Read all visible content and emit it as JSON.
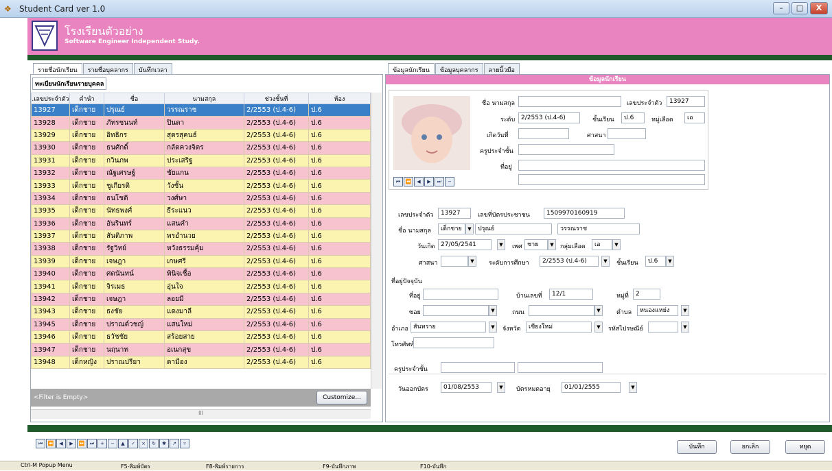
{
  "window": {
    "title": "Student Card ver 1.0",
    "minimize": "–",
    "maximize": "□",
    "close": "X"
  },
  "header": {
    "school_name": "โรงเรียนตัวอย่าง",
    "subtitle": "Software Engineer Independent Study."
  },
  "left": {
    "tabs": [
      "รายชื่อนักเรียน",
      "รายชื่อบุคลากร",
      "บันทึกเวลา"
    ],
    "group_label": "ทะเบียนนักเรียนรายบุคคล",
    "columns": [
      ".เลขประจำตัว",
      "คำนำ",
      "ชื่อ",
      "นามสกุล",
      "ช่วงชั้นที่",
      "ห้อง"
    ],
    "rows": [
      [
        "13927",
        "เด็กชาย",
        "ปรุณย์",
        "วรรณราช",
        "2/2553 (ป.4-6)",
        "ป.6"
      ],
      [
        "13928",
        "เด็กชาย",
        "ภัทรชนนท์",
        "ปินตา",
        "2/2553 (ป.4-6)",
        "ป.6"
      ],
      [
        "13929",
        "เด็กชาย",
        "อิทธิกร",
        "สุตรสุคนธ์",
        "2/2553 (ป.4-6)",
        "ป.6"
      ],
      [
        "13930",
        "เด็กชาย",
        "ธนศักดิ์",
        "กลัดควงจิตร",
        "2/2553 (ป.4-6)",
        "ป.6"
      ],
      [
        "13931",
        "เด็กชาย",
        "กวินภพ",
        "ประเสริฐ",
        "2/2553 (ป.4-6)",
        "ป.6"
      ],
      [
        "13932",
        "เด็กชาย",
        "ณัฐเศรษฐ์",
        "ชัยแกน",
        "2/2553 (ป.4-6)",
        "ป.6"
      ],
      [
        "13933",
        "เด็กชาย",
        "ชูเกียรติ",
        "วังชั้น",
        "2/2553 (ป.4-6)",
        "ป.6"
      ],
      [
        "13934",
        "เด็กชาย",
        "ธนโชติ",
        "วงศ์ษา",
        "2/2553 (ป.4-6)",
        "ป.6"
      ],
      [
        "13935",
        "เด็กชาย",
        "นัทธพงศ์",
        "ธีระแนว",
        "2/2553 (ป.4-6)",
        "ป.6"
      ],
      [
        "13936",
        "เด็กชาย",
        "อันรินทร์",
        "แสนคำ",
        "2/2553 (ป.4-6)",
        "ป.6"
      ],
      [
        "13937",
        "เด็กชาย",
        "สันติภาพ",
        "พรอำนวย",
        "2/2553 (ป.4-6)",
        "ป.6"
      ],
      [
        "13938",
        "เด็กชาย",
        "รัฐวิทย์",
        "หวังธรรมคุ้ม",
        "2/2553 (ป.4-6)",
        "ป.6"
      ],
      [
        "13939",
        "เด็กชาย",
        "เจษฎา",
        "เกษศรี",
        "2/2553 (ป.4-6)",
        "ป.6"
      ],
      [
        "13940",
        "เด็กชาย",
        "ศดนันทน์",
        "พินิจเชื้อ",
        "2/2553 (ป.4-6)",
        "ป.6"
      ],
      [
        "13941",
        "เด็กชาย",
        "จิรเมธ",
        "อุ่นใจ",
        "2/2553 (ป.4-6)",
        "ป.6"
      ],
      [
        "13942",
        "เด็กชาย",
        "เจษฎา",
        "ลอยมี",
        "2/2553 (ป.4-6)",
        "ป.6"
      ],
      [
        "13943",
        "เด็กชาย",
        "ธงชัย",
        "แดงมาลี",
        "2/2553 (ป.4-6)",
        "ป.6"
      ],
      [
        "13945",
        "เด็กชาย",
        "ปราณต์วชญ์",
        "แสนใหม่",
        "2/2553 (ป.4-6)",
        "ป.6"
      ],
      [
        "13946",
        "เด็กชาย",
        "ธวัชชัย",
        "สร้อยสาย",
        "2/2553 (ป.4-6)",
        "ป.6"
      ],
      [
        "13947",
        "เด็กชาย",
        "นฤนาท",
        "อเนกสุข",
        "2/2553 (ป.4-6)",
        "ป.6"
      ],
      [
        "13948",
        "เด็กหญิง",
        "ปราณปรียา",
        "ดามือง",
        "2/2553 (ป.4-6)",
        "ป.6"
      ]
    ],
    "filter_text": "<Filter is Empty>",
    "customize": "Customize...",
    "scroll_mark": "III"
  },
  "right": {
    "tabs": [
      "ข้อมูลนักเรียน",
      "ข้อมูลบุคลากร",
      "ลายนิ้วมือ"
    ],
    "section_title": "ข้อมูลนักเรียน",
    "card": {
      "name_label": "ชื่อ นามสกุล",
      "id_label": "เลขประจำตัว",
      "id_value": "13927",
      "level_label": "ระดับ",
      "level_value": "2/2553 (ป.4-6)",
      "grade_label": "ชั้นเรียน",
      "grade_value": "ป.6",
      "blood_label": "หมู่เลือด",
      "blood_value": "เอ",
      "birth_label": "เกิดวันที่",
      "religion_label": "ศาสนา",
      "teacher_label": "ครูประจำชั้น",
      "address_label": "ที่อยู่"
    },
    "form": {
      "id_label": "เลขประจำตัว",
      "id_value": "13927",
      "citizen_label": "เลขที่บัตรประชาชน",
      "citizen_value": "1509970160919",
      "name_label": "ชื่อ นามสกุล",
      "prefix_value": "เด็กชาย",
      "first_value": "ปรุณย์",
      "last_value": "วรรณราช",
      "birth_label": "วันเกิด",
      "birth_value": "27/05/2541",
      "sex_label": "เพศ",
      "sex_value": "ชาย",
      "blood_label": "กลุ่มเลือด",
      "blood_value": "เอ",
      "religion_label": "ศาสนา",
      "edu_label": "ระดับการศึกษา",
      "edu_value": "2/2553 (ป.4-6)",
      "grade_label": "ชั้นเรียน",
      "grade_value": "ป.6",
      "current_addr_label": "ที่อยู่ปัจจุบัน",
      "addr_label": "ที่อยู่",
      "house_label": "บ้านเลขที่",
      "house_value": "12/1",
      "moo_label": "หมู่ที่",
      "moo_value": "2",
      "soi_label": "ซอย",
      "road_label": "ถนน",
      "tambon_label": "ตำบล",
      "tambon_value": "หนองแหย่ง",
      "amphoe_label": "อำเภอ",
      "amphoe_value": "สันทราย",
      "province_label": "จังหวัด",
      "province_value": "เชียงใหม่",
      "zip_label": "รหัสไปรษณีย์",
      "phone_label": "โทรศัพท์",
      "teacher_label": "ครูประจำชั้น",
      "issue_label": "วันออกบัตร",
      "issue_value": "01/08/2553",
      "expire_label": "บัตรหมดอายุ",
      "expire_value": "01/01/2555"
    }
  },
  "buttons": {
    "save": "บันทึก",
    "cancel": "ยกเลิก",
    "stop": "หยุด"
  },
  "status": {
    "popup": "Ctrl-M  Popup Menu",
    "f5": "F5-พิมพ์บัตร",
    "f8": "F8-พิมพ์รายการ",
    "f9": "F9-บันทึกภาพ",
    "f10": "F10-บันทึก"
  },
  "colors": {
    "header": "#ea84c0",
    "selected_row": "#3a80c8",
    "row_pink": "#f6c3cf",
    "row_yellow": "#fbf4b1",
    "green_bar": "#1f5a2a"
  },
  "icons": [
    "app-icon",
    "school-logo",
    "nav-first-icon",
    "nav-prev-page-icon",
    "nav-prev-icon",
    "nav-next-icon",
    "nav-next-page-icon",
    "nav-last-icon",
    "add-icon",
    "delete-icon",
    "edit-icon",
    "post-icon",
    "cancel-icon",
    "refresh-icon",
    "bookmark-icon",
    "goto-bookmark-icon",
    "filter-icon"
  ]
}
